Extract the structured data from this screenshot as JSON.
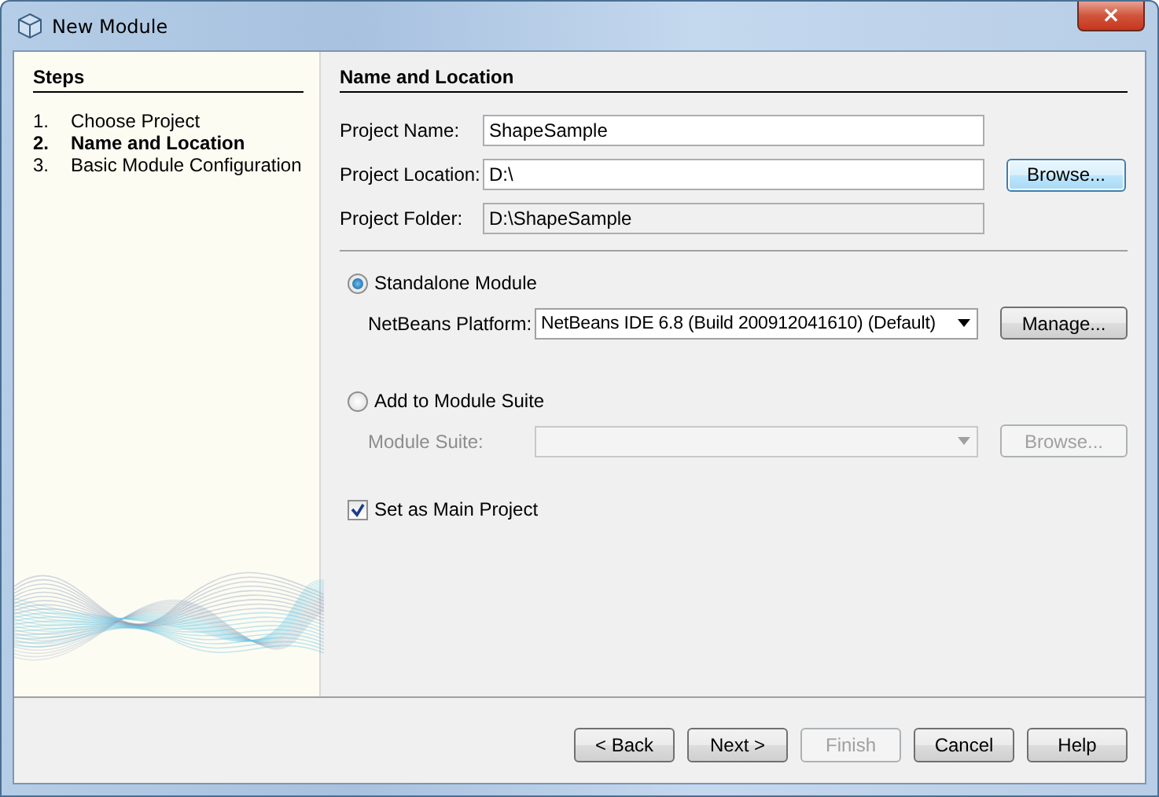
{
  "window": {
    "title": "New Module",
    "close": "×"
  },
  "steps": {
    "title": "Steps",
    "items": [
      {
        "number": "1.",
        "label": "Choose Project",
        "selected": false
      },
      {
        "number": "2.",
        "label": "Name and Location",
        "selected": true
      },
      {
        "number": "3.",
        "label": "Basic Module Configuration",
        "selected": false
      }
    ]
  },
  "panel": {
    "title": "Name and Location",
    "fields": [
      {
        "label": "Project Name:",
        "value": "ShapeSample",
        "editable": true
      },
      {
        "label": "Project Location:",
        "value": "D:\\",
        "editable": true,
        "button": {
          "label": "Browse...",
          "focused": true
        }
      },
      {
        "label": "Project Folder:",
        "value": "D:\\ShapeSample",
        "editable": false
      }
    ]
  },
  "module_options": [
    {
      "label": "Standalone Module",
      "selected": true,
      "combo_label": "NetBeans Platform:",
      "combo_value": "NetBeans IDE 6.8 (Build 200912041610) (Default)",
      "button": "Manage...",
      "disabled": false
    },
    {
      "label": "Add to Module Suite",
      "selected": false,
      "combo_label": "Module Suite:",
      "button": "Browse...",
      "disabled": true
    }
  ],
  "main_project": {
    "label": "Set as Main Project",
    "checked": true
  },
  "buttons": [
    {
      "label": "< Back",
      "disabled": false
    },
    {
      "label": "Next >",
      "disabled": false
    },
    {
      "label": "Finish",
      "disabled": true
    },
    {
      "label": "Cancel",
      "disabled": false
    },
    {
      "label": "Help",
      "disabled": false
    }
  ]
}
